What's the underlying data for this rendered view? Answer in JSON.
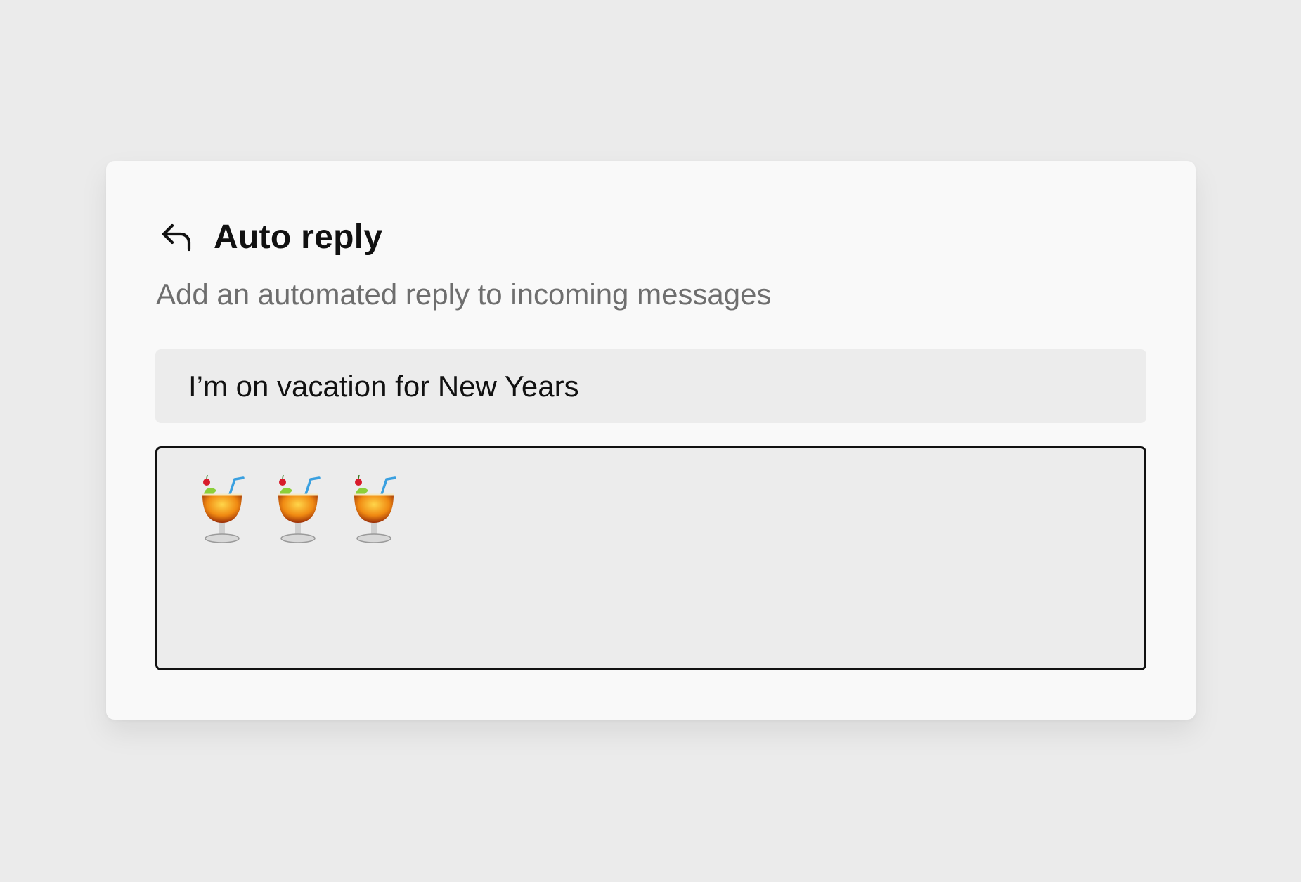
{
  "panel": {
    "title": "Auto reply",
    "description": "Add an automated reply to incoming messages",
    "icon": "reply-arrow-icon"
  },
  "subject_field": {
    "value": "I’m on vacation for New Years"
  },
  "message_field": {
    "value": "🍹🍹🍹",
    "icons": [
      "tropical-drink-icon",
      "tropical-drink-icon",
      "tropical-drink-icon"
    ]
  },
  "colors": {
    "background": "#ebebeb",
    "card": "#f9f9f9",
    "field": "#ececec",
    "title": "#111111",
    "subtitle": "#6e6e6e",
    "focus_border": "#111111"
  }
}
